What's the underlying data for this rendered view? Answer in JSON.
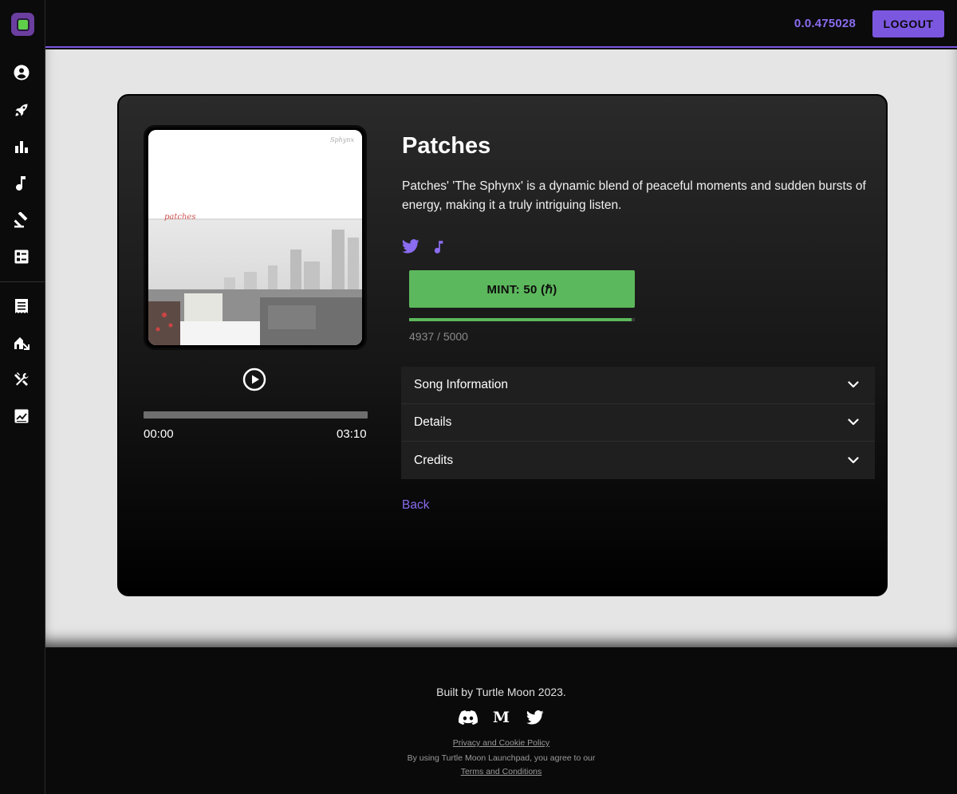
{
  "topbar": {
    "balance": "0.0.475028",
    "logout_label": "LOGOUT"
  },
  "sidebar": {
    "items": [
      {
        "icon": "account-circle-icon"
      },
      {
        "icon": "rocket-icon"
      },
      {
        "icon": "bar-chart-icon"
      },
      {
        "icon": "music-note-icon"
      },
      {
        "icon": "gavel-icon"
      },
      {
        "icon": "dashboard-list-icon"
      },
      {
        "icon": "receipt-icon"
      },
      {
        "icon": "house-arrow-icon"
      },
      {
        "icon": "tools-icon"
      },
      {
        "icon": "trending-chart-icon"
      }
    ]
  },
  "song": {
    "title": "Patches",
    "description": "Patches' 'The Sphynx' is a dynamic blend of peaceful moments and sudden bursts of energy, making it a truly intriguing listen.",
    "art_caption": "patches",
    "art_corner": "Sphynx",
    "time_start": "00:00",
    "time_end": "03:10",
    "playback_progress": 0,
    "mint_label": "MINT: 50 (ℏ)",
    "supply_text": "4937 / 5000",
    "supply_minted": 4937,
    "supply_total": 5000,
    "back_label": "Back"
  },
  "accordion": [
    {
      "label": "Song Information"
    },
    {
      "label": "Details"
    },
    {
      "label": "Credits"
    }
  ],
  "footer": {
    "built_by": "Built by Turtle Moon 2023.",
    "medium_glyph": "M",
    "privacy": "Privacy and Cookie Policy",
    "agree": "By using Turtle Moon Launchpad, you agree to our",
    "terms": "Terms and Conditions"
  },
  "colors": {
    "accent": "#7b57e0",
    "mint_green": "#5cb85c",
    "page_bg": "#e5e5e5"
  }
}
